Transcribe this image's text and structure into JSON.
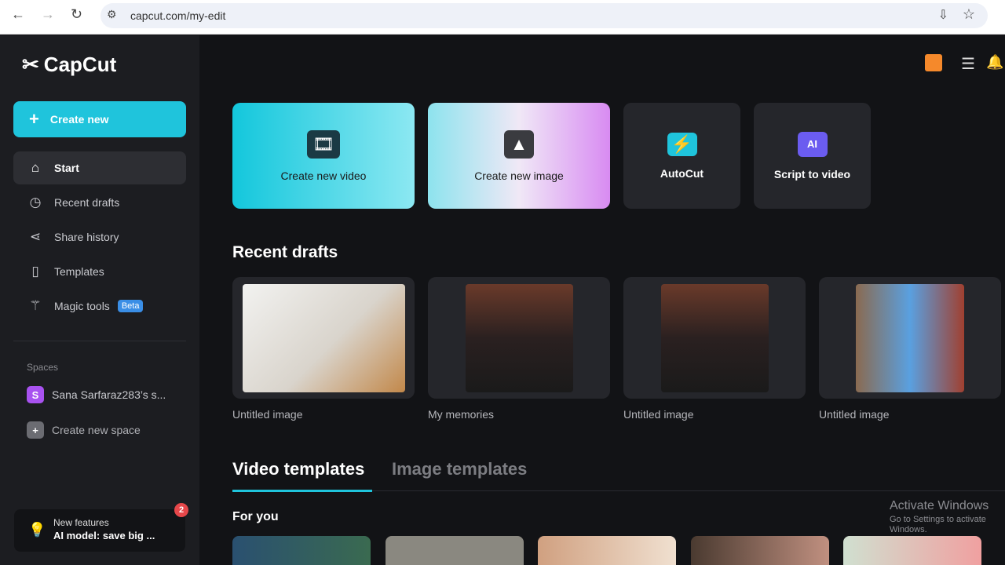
{
  "browser": {
    "url": "capcut.com/my-edit"
  },
  "sidebar": {
    "logo": "CapCut",
    "create_new": "Create new",
    "items": [
      {
        "label": "Start",
        "icon": "home-icon"
      },
      {
        "label": "Recent drafts",
        "icon": "clock-icon"
      },
      {
        "label": "Share history",
        "icon": "share-icon"
      },
      {
        "label": "Templates",
        "icon": "templates-icon"
      },
      {
        "label": "Magic tools",
        "icon": "magic-wand-icon",
        "badge": "Beta"
      }
    ],
    "spaces_heading": "Spaces",
    "space": {
      "initial": "S",
      "name": "Sana Sarfaraz283’s s..."
    },
    "create_space": "Create new space",
    "features": {
      "title": "New features",
      "text": "AI model: save big ...",
      "count": "2"
    }
  },
  "main": {
    "quick": [
      {
        "label": "Create new video"
      },
      {
        "label": "Create new image"
      },
      {
        "label": "AutoCut"
      },
      {
        "label": "Script to video"
      }
    ],
    "recent_heading": "Recent drafts",
    "drafts": [
      {
        "title": "Untitled image"
      },
      {
        "title": "My memories"
      },
      {
        "title": "Untitled image"
      },
      {
        "title": "Untitled image"
      }
    ],
    "tabs": [
      "Video templates",
      "Image templates"
    ],
    "for_you": "For you"
  },
  "watermark": {
    "title": "Activate Windows",
    "subtitle": "Go to Settings to activate Windows."
  },
  "colors": {
    "accent": "#1fc4dc",
    "sidebar": "#1c1d21",
    "bg": "#121316"
  }
}
